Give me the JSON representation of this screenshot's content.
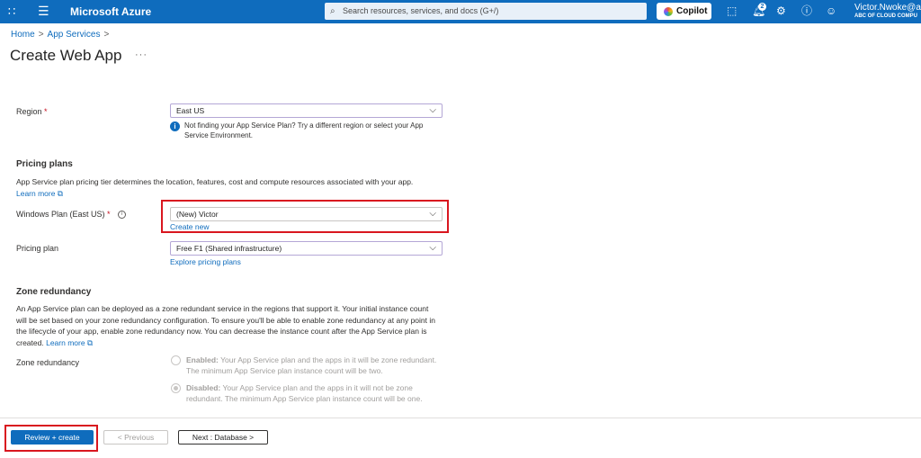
{
  "topbar": {
    "brand": "Microsoft Azure",
    "search_placeholder": "Search resources, services, and docs (G+/)",
    "copilot_label": "Copilot",
    "notifications_count": "2",
    "user_name": "Victor.Nwoke@a",
    "user_tenant": "ABC OF CLOUD COMPU",
    "icons": [
      "portal-menu-grid-icon",
      "hamburger-menu-icon",
      "search-icon",
      "copilot-icon",
      "cloud-shell-icon",
      "notifications-bell-icon",
      "settings-gear-icon",
      "help-icon",
      "feedback-icon"
    ]
  },
  "breadcrumb": {
    "items": [
      "Home",
      "App Services"
    ],
    "separator": ">"
  },
  "page": {
    "title": "Create Web App",
    "more": "···"
  },
  "form": {
    "region": {
      "label": "Region",
      "required": "*",
      "value": "East US",
      "info": "Not finding your App Service Plan? Try a different region or select your App Service Environment."
    },
    "pricing_plans": {
      "heading": "Pricing plans",
      "description": "App Service plan pricing tier determines the location, features, cost and compute resources associated with your app.",
      "learn_more": "Learn more"
    },
    "windows_plan": {
      "label": "Windows Plan (East US)",
      "required": "*",
      "value": "(New) Victor",
      "create_new": "Create new"
    },
    "pricing_plan": {
      "label": "Pricing plan",
      "value": "Free F1 (Shared infrastructure)",
      "explore": "Explore pricing plans"
    },
    "zone_redundancy": {
      "heading": "Zone redundancy",
      "description": "An App Service plan can be deployed as a zone redundant service in the regions that support it. Your initial instance count will be set based on your zone redundancy configuration. To ensure you'll be able to enable zone redundancy at any point in the lifecycle of your app, enable zone redundancy now. You can decrease the instance count after the App Service plan is created.",
      "learn_more": "Learn more",
      "label": "Zone redundancy",
      "options": [
        {
          "title": "Enabled:",
          "text": "Your App Service plan and the apps in it will be zone redundant. The minimum App Service plan instance count will be two.",
          "selected": false
        },
        {
          "title": "Disabled:",
          "text": "Your App Service plan and the apps in it will not be zone redundant. The minimum App Service plan instance count will be one.",
          "selected": true
        }
      ]
    }
  },
  "footer": {
    "review_create": "Review + create",
    "previous": "< Previous",
    "next": "Next : Database >"
  },
  "colors": {
    "azure_blue": "#0f6cbd",
    "highlight_red": "#d9161f",
    "required_red": "#c50f1f"
  }
}
